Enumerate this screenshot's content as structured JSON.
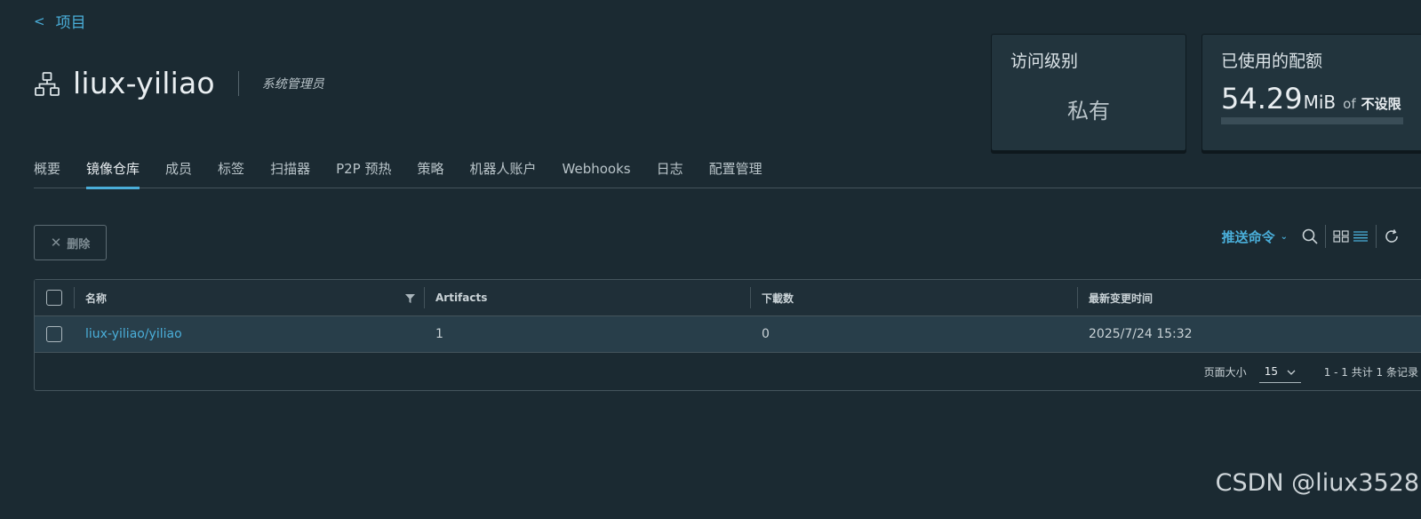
{
  "nav": {
    "back_label": "项目"
  },
  "project": {
    "name": "liux-yiliao",
    "role": "系统管理员",
    "icon": "project-icon"
  },
  "cards": {
    "access": {
      "title": "访问级别",
      "value": "私有"
    },
    "quota": {
      "title": "已使用的配额",
      "used": "54.29",
      "unit": "MiB",
      "of": "of",
      "limit": "不设限"
    }
  },
  "tabs": [
    {
      "label": "概要",
      "active": false
    },
    {
      "label": "镜像仓库",
      "active": true
    },
    {
      "label": "成员",
      "active": false
    },
    {
      "label": "标签",
      "active": false
    },
    {
      "label": "扫描器",
      "active": false
    },
    {
      "label": "P2P 预热",
      "active": false
    },
    {
      "label": "策略",
      "active": false
    },
    {
      "label": "机器人账户",
      "active": false
    },
    {
      "label": "Webhooks",
      "active": false
    },
    {
      "label": "日志",
      "active": false
    },
    {
      "label": "配置管理",
      "active": false
    }
  ],
  "actions": {
    "delete_label": "删除",
    "push_command_label": "推送命令"
  },
  "table": {
    "columns": [
      "名称",
      "Artifacts",
      "下載数",
      "最新变更时间"
    ],
    "rows": [
      {
        "name": "liux-yiliao/yiliao",
        "artifacts": "1",
        "downloads": "0",
        "updated": "2025/7/24 15:32"
      }
    ],
    "footer": {
      "page_size_label": "页面大小",
      "page_size": "15",
      "range_text": "1 - 1 共计 1 条记录"
    }
  },
  "watermark": "CSDN @liux3528",
  "colors": {
    "accent": "#4aaed9",
    "background": "#1b2a32",
    "card": "#22343d"
  }
}
